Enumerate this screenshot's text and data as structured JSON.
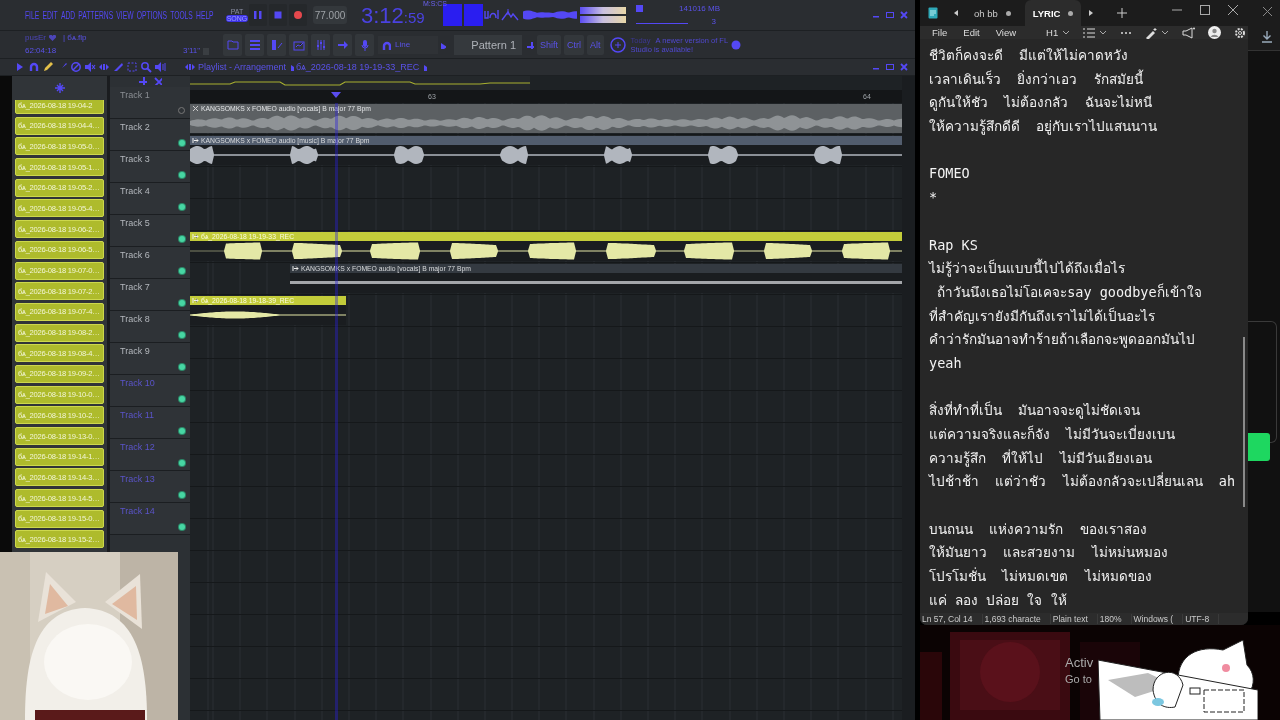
{
  "daw": {
    "menu": [
      "FILE",
      "EDIT",
      "ADD",
      "PATTERNS",
      "VIEW",
      "OPTIONS",
      "TOOLS",
      "HELP"
    ],
    "modes": [
      {
        "label": "PAT",
        "selected": false
      },
      {
        "label": "SONG",
        "selected": true
      }
    ],
    "tempo": "77.000",
    "time": "3:12",
    "time_fraction": ":59",
    "time_format": "M:S:CS",
    "master_meters": [
      {
        "level": 1
      },
      {
        "level": 1
      }
    ],
    "cpu": "14",
    "memory": "1016 MB",
    "polyphony": "3",
    "hint": "pusEr",
    "project": "| бѧ.flp",
    "song_position": "62:04:18",
    "project_length": "3'11\"",
    "snap": "Line",
    "pattern": "Pattern 1",
    "modifiers": [
      "Shift",
      "Ctrl",
      "Alt"
    ],
    "news": {
      "label": "Today",
      "text": "A newer version of FL Studio is available!"
    },
    "playlist": {
      "title": "Playlist - Arrangement",
      "arrangement": "бѧ_2026-08-18 19-19-33_REC",
      "ruler": [
        "63",
        "64"
      ],
      "tracks": [
        {
          "name": "Track 1",
          "muted": true,
          "dimmed": false,
          "clip": {
            "name": "KANGSOMKS x FOMEO audio [vocals] B major 77 Bpm",
            "color": "#5c6063",
            "muted": true
          }
        },
        {
          "name": "Track 2",
          "muted": false,
          "dimmed": false,
          "clip": {
            "name": "KANGSOMKS x FOMEO audio [music] B major 77 Bpm",
            "color": "#525d6e",
            "muted": false
          }
        },
        {
          "name": "Track 3",
          "muted": false,
          "dimmed": false
        },
        {
          "name": "Track 4",
          "muted": false,
          "dimmed": false
        },
        {
          "name": "Track 5",
          "muted": false,
          "dimmed": false,
          "clip": {
            "name": "бѧ_2026-08-18 19-19-33_REC",
            "color": "#c3cc3a",
            "muted": false
          }
        },
        {
          "name": "Track 6",
          "muted": false,
          "dimmed": false,
          "clip": {
            "name": "KANGSOMKS x FOMEO audio [vocals] B major 77 Bpm",
            "color": "#343a41",
            "muted": false
          }
        },
        {
          "name": "Track 7",
          "muted": false,
          "dimmed": false,
          "clip": {
            "name": "бѧ_2026-08-18 19-18-39_REC",
            "color": "#c3cc3a",
            "muted": false
          }
        },
        {
          "name": "Track 8",
          "muted": false,
          "dimmed": false
        },
        {
          "name": "Track 9",
          "muted": false,
          "dimmed": false
        },
        {
          "name": "Track 10",
          "muted": false,
          "dimmed": true
        },
        {
          "name": "Track 11",
          "muted": false,
          "dimmed": true
        },
        {
          "name": "Track 12",
          "muted": false,
          "dimmed": true
        },
        {
          "name": "Track 13",
          "muted": false,
          "dimmed": true
        },
        {
          "name": "Track 14",
          "muted": false,
          "dimmed": true
        }
      ]
    },
    "browser_clips": [
      "бѧ_2026-08-18 19-04-2",
      "бѧ_2026-08-18 19-04-4…",
      "бѧ_2026-08-18 19-05-0…",
      "бѧ_2026-08-18 19-05-1…",
      "бѧ_2026-08-18 19-05-2…",
      "бѧ_2026-08-18 19-05-4…",
      "бѧ_2026-08-18 19-06-2…",
      "бѧ_2026-08-18 19-06-5…",
      "бѧ_2026-08-18 19-07-0…",
      "бѧ_2026-08-18 19-07-2…",
      "бѧ_2026-08-18 19-07-4…",
      "бѧ_2026-08-18 19-08-2…",
      "бѧ_2026-08-18 19-08-4…",
      "бѧ_2026-08-18 19-09-2…",
      "бѧ_2026-08-18 19-10-0…",
      "бѧ_2026-08-18 19-10-2…",
      "бѧ_2026-08-18 19-13-0…",
      "бѧ_2026-08-18 19-14-1…",
      "бѧ_2026-08-18 19-14-3…",
      "бѧ_2026-08-18 19-14-5…",
      "бѧ_2026-08-18 19-15-0…",
      "бѧ_2026-08-18 19-15-2…"
    ]
  },
  "notepad": {
    "tabs": [
      {
        "label": "oh bb",
        "selected": false
      },
      {
        "label": "LYRIC",
        "selected": true
      }
    ],
    "menu": [
      "File",
      "Edit",
      "View"
    ],
    "heading": "H1",
    "stanzas": [
      [
        "ชีวิตก็คงจะดี  มีแต่ให้ไม่คาดหวัง",
        "เวลาเดินเร็ว  ยิ่งกว่าเอว  รักสมัยนี้",
        "ดูกันให้ชัว  ไม่ต้องกลัว  ฉันจะไม่หนี",
        "ให้ความรู้สึกดีดี  อยู่กับเราไปแสนนาน"
      ],
      [
        "FOMEO",
        "*"
      ],
      [
        "Rap KS",
        "ไม่รู้ว่าจะเป็นแบบนี้ไปได้ถึงเมื่อไร",
        " ถ้าวันนึงเธอไม่โอเคจะsay goodbyeก็เข้าใจ",
        "ที่สำคัญเรายังมีกันถึงเราไม่ได้เป็นอะไร",
        "คำว่ารักมันอาจทำร้ายถ้าเลือกจะพูดออกมันไป",
        "yeah"
      ],
      [
        "สิ่งที่ทำที่เป็น  มันอาจจะดูไม่ชัดเจน",
        "แต่ความจริงและก็จัง  ไม่มีวันจะเบี่ยงเบน",
        "ความรู้สึก  ที่ให้ไป  ไม่มีวันเอียงเอน",
        "ไปช้าช้า  แต่ว่าชัว  ไม่ต้องกลัวจะเปลี่ยนเลน  ah"
      ],
      [
        "บนถนน  แห่งความรัก  ของเราสอง",
        "ให้มันยาว  และสวยงาม  ไม่หม่นหมอง",
        "โปรโมชั่น  ไม่หมดเขต  ไม่หมดของ",
        "แค่ ลอง ปล่อย ใจ ให้"
      ]
    ],
    "status": [
      "Ln 57, Col 14",
      "1,693 characte",
      "Plain text",
      "180%",
      "Windows (",
      "UTF-8"
    ]
  },
  "desktop": {
    "activation": [
      "Activ",
      "Go to"
    ]
  }
}
